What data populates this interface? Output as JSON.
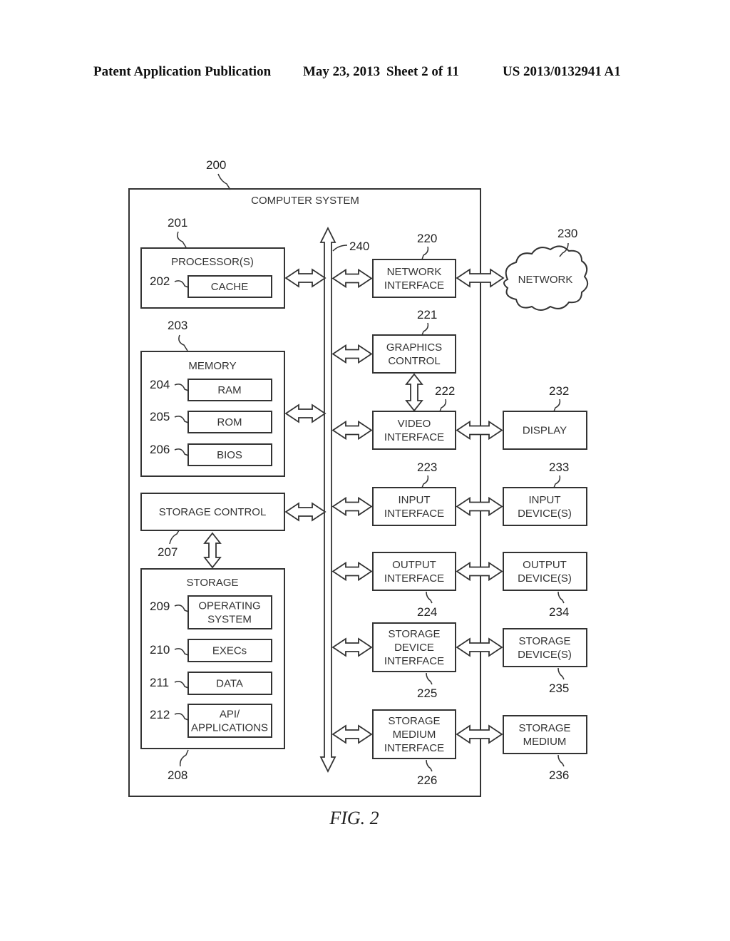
{
  "header": {
    "publication": "Patent Application Publication",
    "date": "May 23, 2013",
    "sheet": "Sheet 2 of 11",
    "number": "US 2013/0132941 A1"
  },
  "figure": {
    "caption": "FIG. 2"
  },
  "system": {
    "ref": "200",
    "title": "COMPUTER SYSTEM"
  },
  "bus": {
    "ref": "240"
  },
  "processor": {
    "ref": "201",
    "title": "PROCESSOR(S)",
    "cache": {
      "ref": "202",
      "label": "CACHE"
    }
  },
  "memory": {
    "ref": "203",
    "title": "MEMORY",
    "items": [
      {
        "ref": "204",
        "label": "RAM"
      },
      {
        "ref": "205",
        "label": "ROM"
      },
      {
        "ref": "206",
        "label": "BIOS"
      }
    ]
  },
  "storage_control": {
    "ref": "207",
    "label": "STORAGE CONTROL"
  },
  "storage": {
    "ref": "208",
    "title": "STORAGE",
    "items": [
      {
        "ref": "209",
        "lines": [
          "OPERATING",
          "SYSTEM"
        ]
      },
      {
        "ref": "210",
        "lines": [
          "EXECs"
        ]
      },
      {
        "ref": "211",
        "lines": [
          "DATA"
        ]
      },
      {
        "ref": "212",
        "lines": [
          "API/",
          "APPLICATIONS"
        ]
      }
    ]
  },
  "interfaces": [
    {
      "ref": "220",
      "lines": [
        "NETWORK",
        "INTERFACE"
      ]
    },
    {
      "ref": "221",
      "lines": [
        "GRAPHICS",
        "CONTROL"
      ]
    },
    {
      "ref": "222",
      "lines": [
        "VIDEO",
        "INTERFACE"
      ]
    },
    {
      "ref": "223",
      "lines": [
        "INPUT",
        "INTERFACE"
      ]
    },
    {
      "ref": "224",
      "lines": [
        "OUTPUT",
        "INTERFACE"
      ]
    },
    {
      "ref": "225",
      "lines": [
        "STORAGE",
        "DEVICE",
        "INTERFACE"
      ]
    },
    {
      "ref": "226",
      "lines": [
        "STORAGE",
        "MEDIUM",
        "INTERFACE"
      ]
    }
  ],
  "externals": [
    {
      "ref": "230",
      "lines": [
        "NETWORK"
      ]
    },
    {
      "ref": "232",
      "lines": [
        "DISPLAY"
      ]
    },
    {
      "ref": "233",
      "lines": [
        "INPUT",
        "DEVICE(S)"
      ]
    },
    {
      "ref": "234",
      "lines": [
        "OUTPUT",
        "DEVICE(S)"
      ]
    },
    {
      "ref": "235",
      "lines": [
        "STORAGE",
        "DEVICE(S)"
      ]
    },
    {
      "ref": "236",
      "lines": [
        "STORAGE",
        "MEDIUM"
      ]
    }
  ]
}
